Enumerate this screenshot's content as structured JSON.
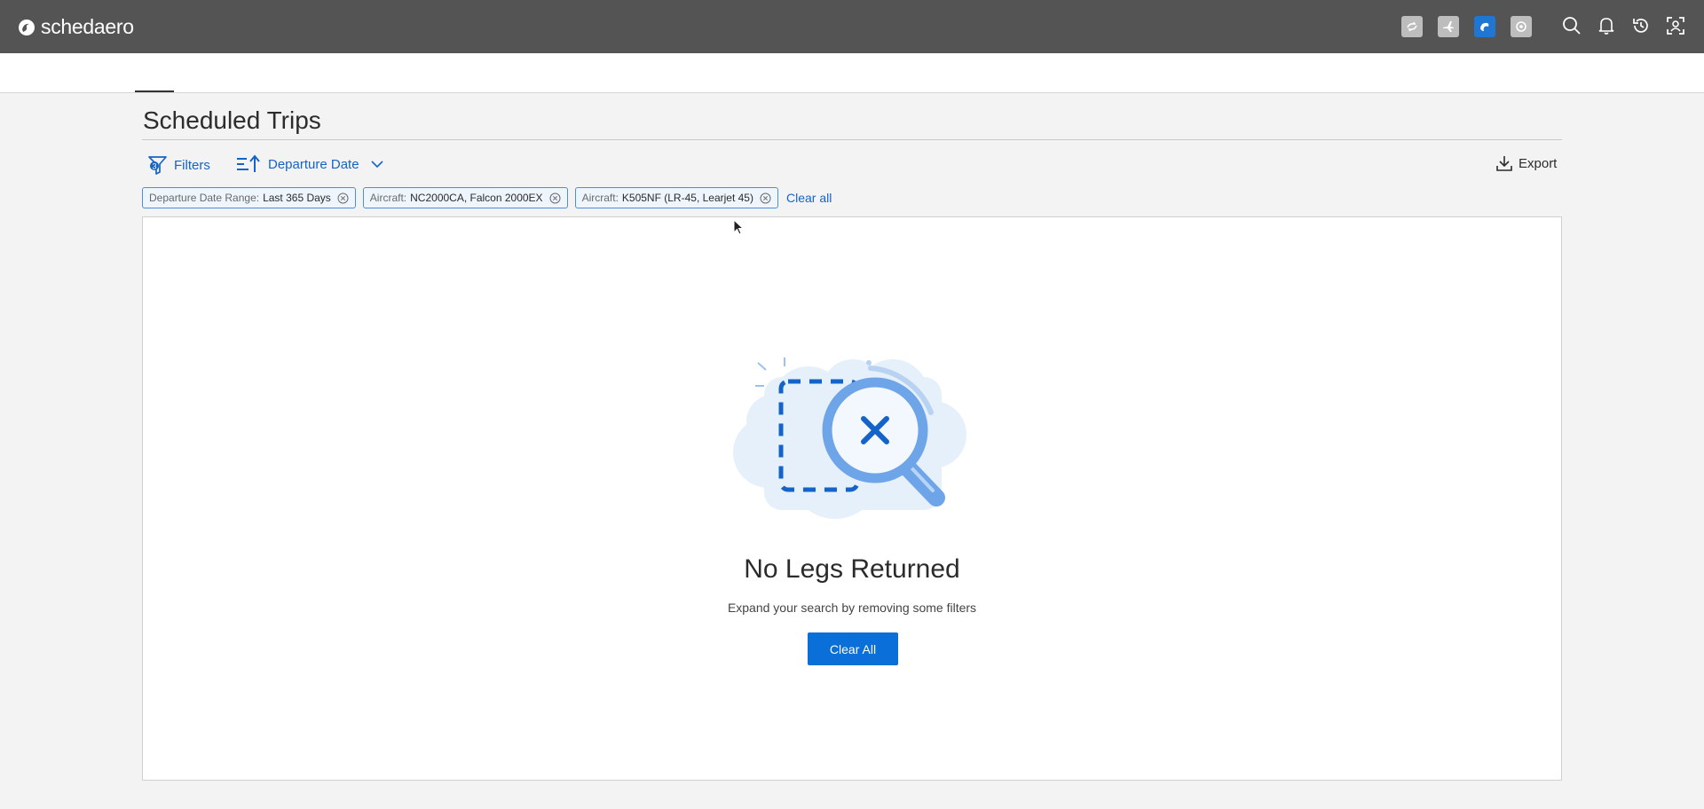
{
  "header": {
    "brand": "schedaero",
    "app_icons": [
      "sync-icon",
      "plane-icon",
      "schedaero-app-icon",
      "support-icon"
    ],
    "util_icons": [
      "search-icon",
      "bell-icon",
      "history-icon",
      "user-scan-icon"
    ]
  },
  "page": {
    "title": "Scheduled Trips"
  },
  "toolbar": {
    "filters_label": "Filters",
    "sort_label": "Departure Date",
    "export_label": "Export"
  },
  "chips": [
    {
      "key": "Departure Date Range:",
      "value": "Last 365 Days"
    },
    {
      "key": "Aircraft:",
      "value": "NC2000CA, Falcon 2000EX"
    },
    {
      "key": "Aircraft:",
      "value": "K505NF (LR-45, Learjet 45)"
    }
  ],
  "clear_all_link": "Clear all",
  "empty_state": {
    "title": "No Legs Returned",
    "subtitle": "Expand your search by removing some filters",
    "button_label": "Clear All"
  },
  "colors": {
    "topbar": "#545454",
    "accent": "#0a6fd8",
    "link": "#1663c7",
    "chip_border": "#4a8fdc"
  }
}
